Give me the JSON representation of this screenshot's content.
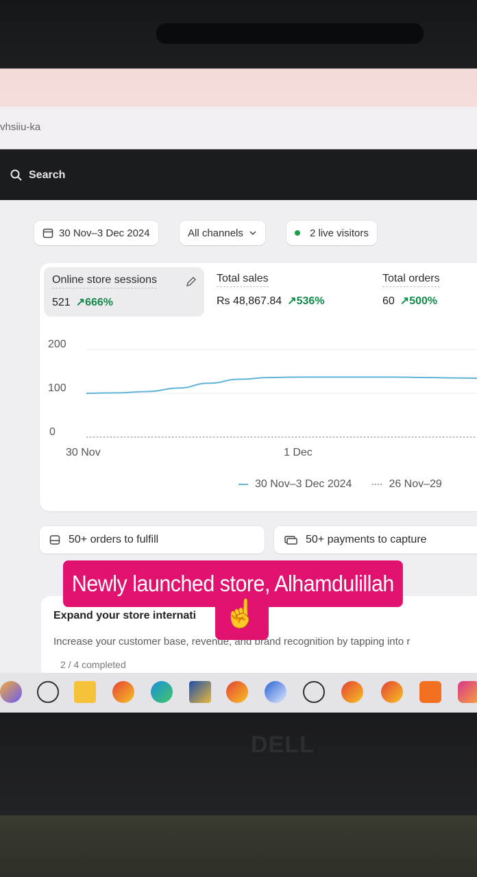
{
  "browser": {
    "url_fragment": "vhsiiu-ka"
  },
  "topbar": {
    "search_label": "Search"
  },
  "filters": {
    "date_range": "30 Nov–3 Dec 2024",
    "channels": "All channels",
    "live_visitors": "2 live visitors"
  },
  "metrics": [
    {
      "label": "Online store sessions",
      "value": "521",
      "change": "666%"
    },
    {
      "label": "Total sales",
      "value": "Rs 48,867.84",
      "change": "536%"
    },
    {
      "label": "Total orders",
      "value": "60",
      "change": "500%"
    }
  ],
  "chart_data": {
    "type": "line",
    "y_ticks": [
      "200",
      "100",
      "0"
    ],
    "x_ticks": [
      "30 Nov",
      "1 Dec"
    ],
    "ylim": [
      0,
      200
    ],
    "series": [
      {
        "name": "30 Nov–3 Dec 2024",
        "color": "#5fb4d8",
        "values": [
          100,
          101,
          104,
          112,
          123,
          132,
          136,
          137,
          137,
          137,
          137,
          136,
          135,
          134
        ]
      },
      {
        "name": "26 Nov–29",
        "color": "#9aa0a8",
        "values": [
          0,
          0,
          0,
          0,
          0,
          0,
          0,
          0,
          0,
          0,
          0,
          0,
          0,
          0
        ]
      }
    ]
  },
  "tasks": {
    "orders": "50+ orders to fulfill",
    "payments": "50+ payments to capture"
  },
  "setup": {
    "title": "Expand your store internati",
    "description": "Increase your customer base, revenue, and brand recognition by tapping into r",
    "progress": "2 / 4 completed"
  },
  "overlay": {
    "caption": "Newly launched store, Alhamdulillah",
    "emoji": "☝"
  },
  "laptop": {
    "brand": "DELL"
  },
  "taskbar_icons": [
    "copilot-icon",
    "whatsapp-icon",
    "file-explorer-icon",
    "chrome-icon",
    "edge-icon",
    "store-icon",
    "chrome-icon",
    "browser-icon",
    "whatsapp-icon",
    "chrome-icon",
    "chrome-icon",
    "notes-icon",
    "instagram-icon"
  ],
  "colors": {
    "accent_green": "#128a4b",
    "caption_pink": "#e0116f",
    "series_blue": "#5fb4d8"
  }
}
